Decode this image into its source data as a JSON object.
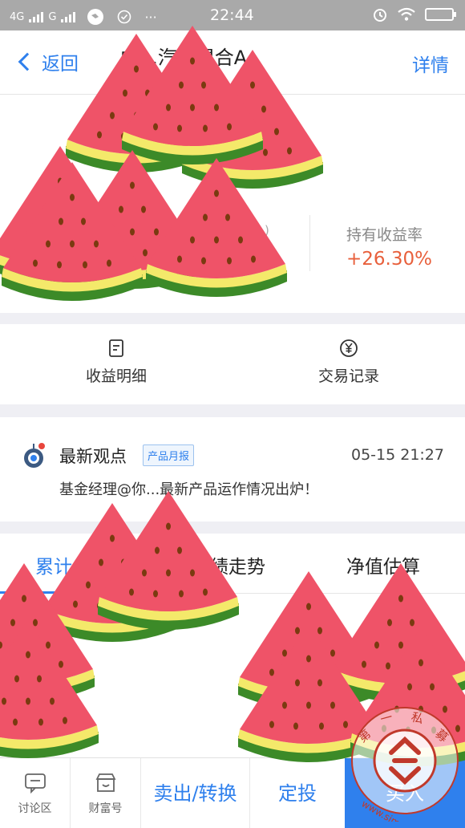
{
  "status_bar": {
    "network_1": "4G",
    "network_2": "G",
    "time": "22:44",
    "menu_dots": "···"
  },
  "nav": {
    "back_label": "返回",
    "title": "中...汽...混合A",
    "detail_label": "详情"
  },
  "summary": {
    "paren_text": ")",
    "rate_label": "持有收益率",
    "rate_value": "+26.30%",
    "rate_color": "#e8603c"
  },
  "quick_actions": [
    {
      "label": "收益明细",
      "icon": "document-icon"
    },
    {
      "label": "交易记录",
      "icon": "yuan-icon"
    }
  ],
  "news": {
    "title": "最新观点",
    "tag": "产品月报",
    "time": "05-15 21:27",
    "body": "基金经理@你...最新产品运作情况出炉！"
  },
  "tabs": [
    {
      "label": "累计"
    },
    {
      "label": "...绩走势"
    },
    {
      "label": "净值估算"
    }
  ],
  "bottom_bar": {
    "discuss_label": "讨论区",
    "wealth_label": "财富号",
    "sell_label": "卖出/转换",
    "plan_label": "定投",
    "buy_label": "买入"
  },
  "watermark_text": "第一私募 www.simu001.cn",
  "colors": {
    "accent": "#2f80ed",
    "watermelon_flesh": "#ef5368",
    "rind_yellow": "#f4e96a",
    "rind_green": "#3c8a28"
  }
}
